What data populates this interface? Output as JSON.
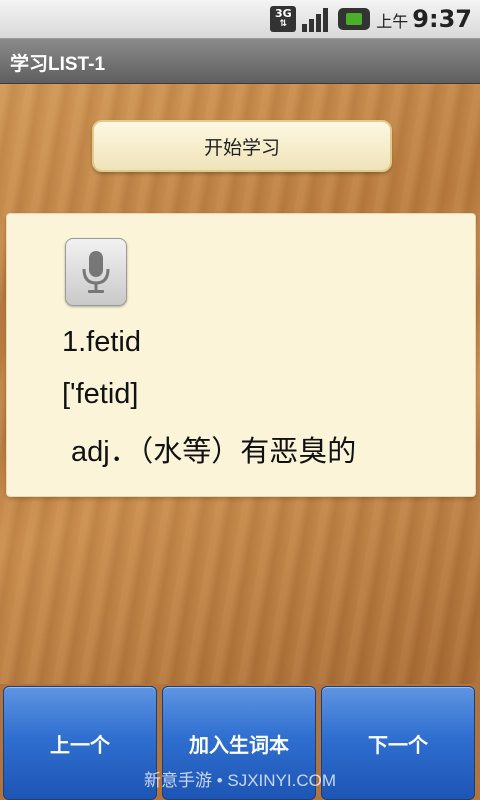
{
  "status_bar": {
    "network_label": "3G",
    "ampm": "上午",
    "time": "9:37",
    "icons": [
      "3g-signal-icon",
      "signal-bars-icon",
      "battery-icon"
    ]
  },
  "title_bar": {
    "title": "学习LIST-1"
  },
  "start_button": {
    "label": "开始学习"
  },
  "word_card": {
    "word": "1.fetid",
    "phonetic": "['fetid]",
    "definition": "adj．（水等）有恶臭的",
    "pronounce_icon": "microphone-icon"
  },
  "bottom_buttons": {
    "prev_label": "上一个",
    "add_label": "加入生词本",
    "next_label": "下一个"
  },
  "watermark": {
    "text": "新意手游 • SJXINYI.COM"
  },
  "colors": {
    "button_blue": "#2f6fd0",
    "card_bg": "#fbf4d9",
    "title_bar": "#707070"
  }
}
